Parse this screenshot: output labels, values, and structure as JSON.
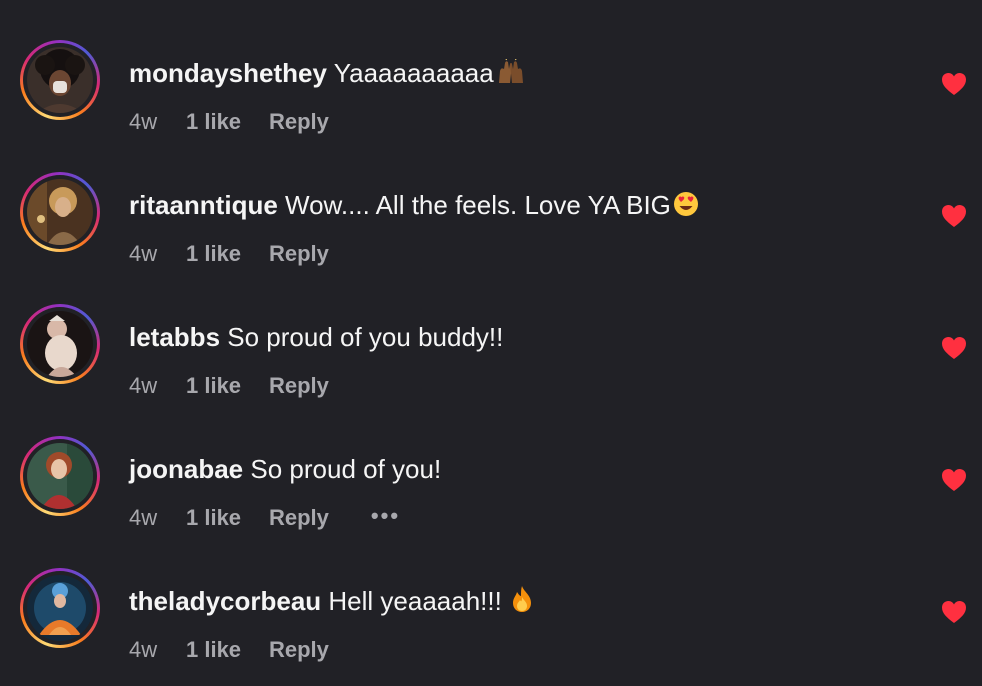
{
  "colors": {
    "background": "#212126",
    "heart": "#ff3040",
    "meta_text": "#a8a8ad"
  },
  "comments": [
    {
      "username": "mondayshethey",
      "text": "Yaaaaaaaaaa",
      "emoji_icon": "raised-hands-icon",
      "time": "4w",
      "likes": "1 like",
      "reply": "Reply"
    },
    {
      "username": "ritaanntique",
      "text": "Wow.... All the feels. Love YA BIG",
      "emoji_icon": "heart-eyes-icon",
      "time": "4w",
      "likes": "1 like",
      "reply": "Reply"
    },
    {
      "username": "letabbs",
      "text": "So proud of you buddy!!",
      "time": "4w",
      "likes": "1 like",
      "reply": "Reply"
    },
    {
      "username": "joonabae",
      "text": "So proud of you!",
      "time": "4w",
      "likes": "1 like",
      "reply": "Reply",
      "more": "•••"
    },
    {
      "username": "theladycorbeau",
      "text": "Hell yeaaaah!!!",
      "emoji_icon": "fire-icon",
      "time": "4w",
      "likes": "1 like",
      "reply": "Reply"
    }
  ]
}
